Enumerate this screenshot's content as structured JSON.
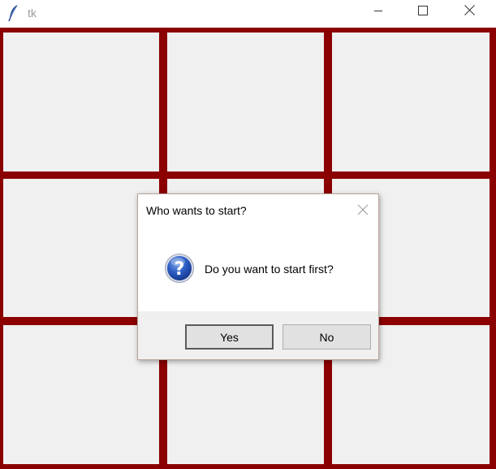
{
  "window": {
    "title": "tk",
    "icons": {
      "app": "feather-icon",
      "minimize": "minimize-icon",
      "maximize": "maximize-icon",
      "close": "close-icon"
    }
  },
  "board": {
    "grid_color": "#8b0000",
    "cell_color": "#f0f0f0",
    "rows": 3,
    "cols": 3
  },
  "dialog": {
    "title": "Who wants to start?",
    "message": "Do you want to start first?",
    "icon": "question-icon",
    "close_icon": "close-icon",
    "buttons": {
      "yes": "Yes",
      "no": "No"
    }
  }
}
